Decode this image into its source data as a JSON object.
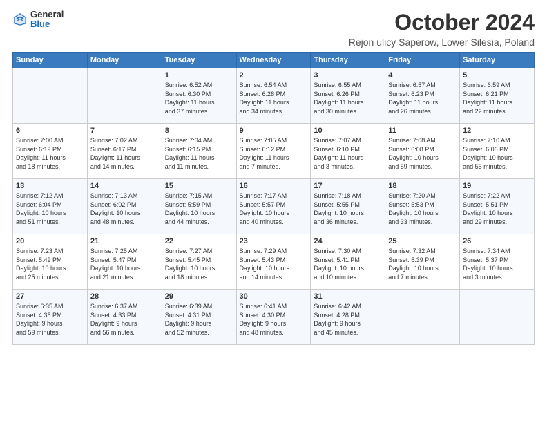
{
  "logo": {
    "general": "General",
    "blue": "Blue"
  },
  "title": "October 2024",
  "location": "Rejon ulicy Saperow, Lower Silesia, Poland",
  "headers": [
    "Sunday",
    "Monday",
    "Tuesday",
    "Wednesday",
    "Thursday",
    "Friday",
    "Saturday"
  ],
  "rows": [
    [
      {
        "day": "",
        "info": ""
      },
      {
        "day": "",
        "info": ""
      },
      {
        "day": "1",
        "info": "Sunrise: 6:52 AM\nSunset: 6:30 PM\nDaylight: 11 hours\nand 37 minutes."
      },
      {
        "day": "2",
        "info": "Sunrise: 6:54 AM\nSunset: 6:28 PM\nDaylight: 11 hours\nand 34 minutes."
      },
      {
        "day": "3",
        "info": "Sunrise: 6:55 AM\nSunset: 6:26 PM\nDaylight: 11 hours\nand 30 minutes."
      },
      {
        "day": "4",
        "info": "Sunrise: 6:57 AM\nSunset: 6:23 PM\nDaylight: 11 hours\nand 26 minutes."
      },
      {
        "day": "5",
        "info": "Sunrise: 6:59 AM\nSunset: 6:21 PM\nDaylight: 11 hours\nand 22 minutes."
      }
    ],
    [
      {
        "day": "6",
        "info": "Sunrise: 7:00 AM\nSunset: 6:19 PM\nDaylight: 11 hours\nand 18 minutes."
      },
      {
        "day": "7",
        "info": "Sunrise: 7:02 AM\nSunset: 6:17 PM\nDaylight: 11 hours\nand 14 minutes."
      },
      {
        "day": "8",
        "info": "Sunrise: 7:04 AM\nSunset: 6:15 PM\nDaylight: 11 hours\nand 11 minutes."
      },
      {
        "day": "9",
        "info": "Sunrise: 7:05 AM\nSunset: 6:12 PM\nDaylight: 11 hours\nand 7 minutes."
      },
      {
        "day": "10",
        "info": "Sunrise: 7:07 AM\nSunset: 6:10 PM\nDaylight: 11 hours\nand 3 minutes."
      },
      {
        "day": "11",
        "info": "Sunrise: 7:08 AM\nSunset: 6:08 PM\nDaylight: 10 hours\nand 59 minutes."
      },
      {
        "day": "12",
        "info": "Sunrise: 7:10 AM\nSunset: 6:06 PM\nDaylight: 10 hours\nand 55 minutes."
      }
    ],
    [
      {
        "day": "13",
        "info": "Sunrise: 7:12 AM\nSunset: 6:04 PM\nDaylight: 10 hours\nand 51 minutes."
      },
      {
        "day": "14",
        "info": "Sunrise: 7:13 AM\nSunset: 6:02 PM\nDaylight: 10 hours\nand 48 minutes."
      },
      {
        "day": "15",
        "info": "Sunrise: 7:15 AM\nSunset: 5:59 PM\nDaylight: 10 hours\nand 44 minutes."
      },
      {
        "day": "16",
        "info": "Sunrise: 7:17 AM\nSunset: 5:57 PM\nDaylight: 10 hours\nand 40 minutes."
      },
      {
        "day": "17",
        "info": "Sunrise: 7:18 AM\nSunset: 5:55 PM\nDaylight: 10 hours\nand 36 minutes."
      },
      {
        "day": "18",
        "info": "Sunrise: 7:20 AM\nSunset: 5:53 PM\nDaylight: 10 hours\nand 33 minutes."
      },
      {
        "day": "19",
        "info": "Sunrise: 7:22 AM\nSunset: 5:51 PM\nDaylight: 10 hours\nand 29 minutes."
      }
    ],
    [
      {
        "day": "20",
        "info": "Sunrise: 7:23 AM\nSunset: 5:49 PM\nDaylight: 10 hours\nand 25 minutes."
      },
      {
        "day": "21",
        "info": "Sunrise: 7:25 AM\nSunset: 5:47 PM\nDaylight: 10 hours\nand 21 minutes."
      },
      {
        "day": "22",
        "info": "Sunrise: 7:27 AM\nSunset: 5:45 PM\nDaylight: 10 hours\nand 18 minutes."
      },
      {
        "day": "23",
        "info": "Sunrise: 7:29 AM\nSunset: 5:43 PM\nDaylight: 10 hours\nand 14 minutes."
      },
      {
        "day": "24",
        "info": "Sunrise: 7:30 AM\nSunset: 5:41 PM\nDaylight: 10 hours\nand 10 minutes."
      },
      {
        "day": "25",
        "info": "Sunrise: 7:32 AM\nSunset: 5:39 PM\nDaylight: 10 hours\nand 7 minutes."
      },
      {
        "day": "26",
        "info": "Sunrise: 7:34 AM\nSunset: 5:37 PM\nDaylight: 10 hours\nand 3 minutes."
      }
    ],
    [
      {
        "day": "27",
        "info": "Sunrise: 6:35 AM\nSunset: 4:35 PM\nDaylight: 9 hours\nand 59 minutes."
      },
      {
        "day": "28",
        "info": "Sunrise: 6:37 AM\nSunset: 4:33 PM\nDaylight: 9 hours\nand 56 minutes."
      },
      {
        "day": "29",
        "info": "Sunrise: 6:39 AM\nSunset: 4:31 PM\nDaylight: 9 hours\nand 52 minutes."
      },
      {
        "day": "30",
        "info": "Sunrise: 6:41 AM\nSunset: 4:30 PM\nDaylight: 9 hours\nand 48 minutes."
      },
      {
        "day": "31",
        "info": "Sunrise: 6:42 AM\nSunset: 4:28 PM\nDaylight: 9 hours\nand 45 minutes."
      },
      {
        "day": "",
        "info": ""
      },
      {
        "day": "",
        "info": ""
      }
    ]
  ]
}
